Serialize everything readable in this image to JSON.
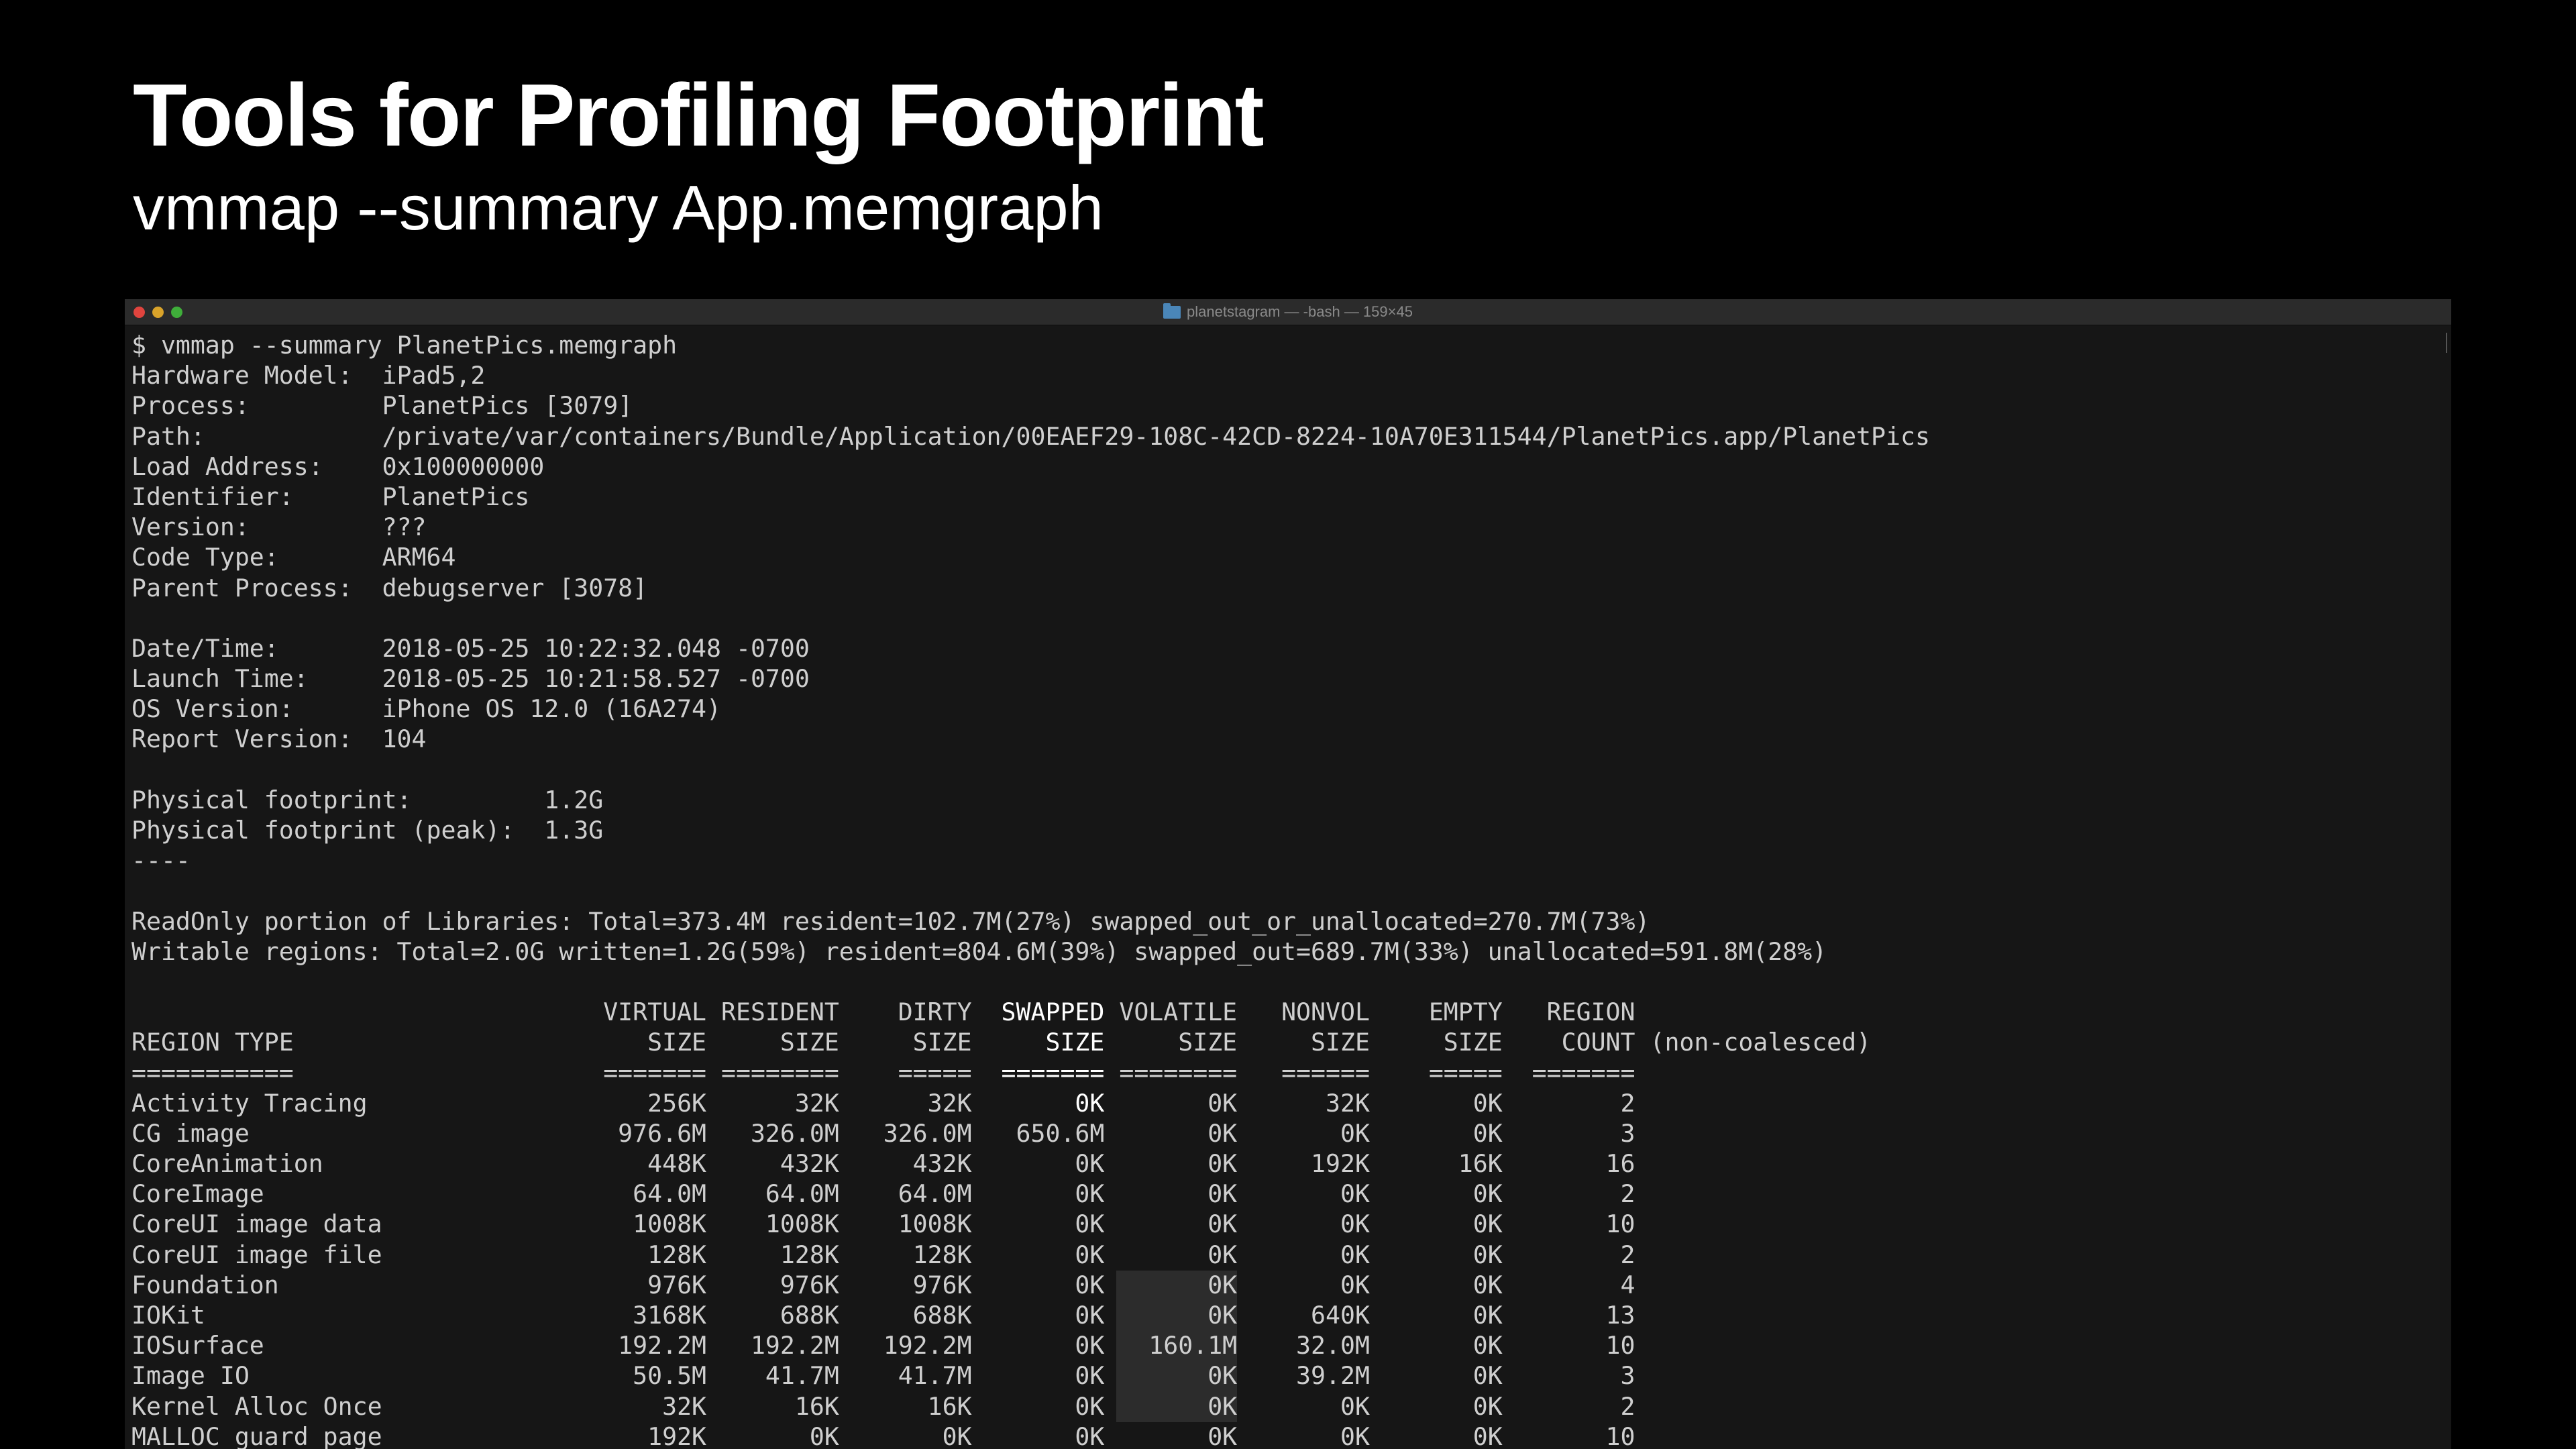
{
  "slide": {
    "title": "Tools for Profiling Footprint",
    "subtitle": "vmmap --summary App.memgraph"
  },
  "window": {
    "title": "planetstagram — -bash — 159×45",
    "folder_icon": "folder-icon",
    "traffic_lights": {
      "close": "#e0443e",
      "minimize": "#d9a32a",
      "maximize": "#3fae3a"
    }
  },
  "terminal": {
    "command": "$ vmmap --summary PlanetPics.memgraph",
    "header_lines": [
      "Hardware Model:  iPad5,2",
      "Process:         PlanetPics [3079]",
      "Path:            /private/var/containers/Bundle/Application/00EAEF29-108C-42CD-8224-10A70E311544/PlanetPics.app/PlanetPics",
      "Load Address:    0x100000000",
      "Identifier:      PlanetPics",
      "Version:         ???",
      "Code Type:       ARM64",
      "Parent Process:  debugserver [3078]",
      "",
      "Date/Time:       2018-05-25 10:22:32.048 -0700",
      "Launch Time:     2018-05-25 10:21:58.527 -0700",
      "OS Version:      iPhone OS 12.0 (16A274)",
      "Report Version:  104",
      "",
      "Physical footprint:         1.2G",
      "Physical footprint (peak):  1.3G",
      "----",
      "",
      "ReadOnly portion of Libraries: Total=373.4M resident=102.7M(27%) swapped_out_or_unallocated=270.7M(73%)",
      "Writable regions: Total=2.0G written=1.2G(59%) resident=804.6M(39%) swapped_out=689.7M(33%) unallocated=591.8M(28%)",
      ""
    ],
    "table": {
      "header_row_1": {
        "region": "",
        "virtual": "VIRTUAL",
        "resident": "RESIDENT",
        "dirty": "DIRTY",
        "swapped": "SWAPPED",
        "volatile": "VOLATILE",
        "nonvol": "NONVOL",
        "empty": "EMPTY",
        "count": "REGION",
        "note": ""
      },
      "header_row_2": {
        "region": "REGION TYPE",
        "virtual": "SIZE",
        "resident": "SIZE",
        "dirty": "SIZE",
        "swapped": "SIZE",
        "volatile": "SIZE",
        "nonvol": "SIZE",
        "empty": "SIZE",
        "count": "COUNT",
        "note": " (non-coalesced)"
      },
      "separator_row": {
        "region": "===========",
        "virtual": "=======",
        "resident": "========",
        "dirty": "=====",
        "swapped": "=======",
        "volatile": "========",
        "nonvol": "======",
        "empty": "=====",
        "count": "=======",
        "note": ""
      },
      "rows": [
        {
          "region": "Activity Tracing",
          "virtual": "256K",
          "resident": "32K",
          "dirty": "32K",
          "swapped": "0K",
          "volatile": "0K",
          "nonvol": "32K",
          "empty": "0K",
          "count": "2"
        },
        {
          "region": "CG image",
          "virtual": "976.6M",
          "resident": "326.0M",
          "dirty": "326.0M",
          "swapped": "650.6M",
          "volatile": "0K",
          "nonvol": "0K",
          "empty": "0K",
          "count": "3"
        },
        {
          "region": "CoreAnimation",
          "virtual": "448K",
          "resident": "432K",
          "dirty": "432K",
          "swapped": "0K",
          "volatile": "0K",
          "nonvol": "192K",
          "empty": "16K",
          "count": "16"
        },
        {
          "region": "CoreImage",
          "virtual": "64.0M",
          "resident": "64.0M",
          "dirty": "64.0M",
          "swapped": "0K",
          "volatile": "0K",
          "nonvol": "0K",
          "empty": "0K",
          "count": "2"
        },
        {
          "region": "CoreUI image data",
          "virtual": "1008K",
          "resident": "1008K",
          "dirty": "1008K",
          "swapped": "0K",
          "volatile": "0K",
          "nonvol": "0K",
          "empty": "0K",
          "count": "10"
        },
        {
          "region": "CoreUI image file",
          "virtual": "128K",
          "resident": "128K",
          "dirty": "128K",
          "swapped": "0K",
          "volatile": "0K",
          "nonvol": "0K",
          "empty": "0K",
          "count": "2"
        },
        {
          "region": "Foundation",
          "virtual": "976K",
          "resident": "976K",
          "dirty": "976K",
          "swapped": "0K",
          "volatile": "0K",
          "nonvol": "0K",
          "empty": "0K",
          "count": "4"
        },
        {
          "region": "IOKit",
          "virtual": "3168K",
          "resident": "688K",
          "dirty": "688K",
          "swapped": "0K",
          "volatile": "0K",
          "nonvol": "640K",
          "empty": "0K",
          "count": "13"
        },
        {
          "region": "IOSurface",
          "virtual": "192.2M",
          "resident": "192.2M",
          "dirty": "192.2M",
          "swapped": "0K",
          "volatile": "160.1M",
          "nonvol": "32.0M",
          "empty": "0K",
          "count": "10"
        },
        {
          "region": "Image IO",
          "virtual": "50.5M",
          "resident": "41.7M",
          "dirty": "41.7M",
          "swapped": "0K",
          "volatile": "0K",
          "nonvol": "39.2M",
          "empty": "0K",
          "count": "3"
        },
        {
          "region": "Kernel Alloc Once",
          "virtual": "32K",
          "resident": "16K",
          "dirty": "16K",
          "swapped": "0K",
          "volatile": "0K",
          "nonvol": "0K",
          "empty": "0K",
          "count": "2"
        },
        {
          "region": "MALLOC guard page",
          "virtual": "192K",
          "resident": "0K",
          "dirty": "0K",
          "swapped": "0K",
          "volatile": "0K",
          "nonvol": "0K",
          "empty": "0K",
          "count": "10"
        }
      ]
    }
  },
  "colors": {
    "slide_background": "#000000",
    "terminal_background": "#161616",
    "terminal_text": "#cfcfcf",
    "swapped_column_highlight": "#2c2c2c"
  }
}
